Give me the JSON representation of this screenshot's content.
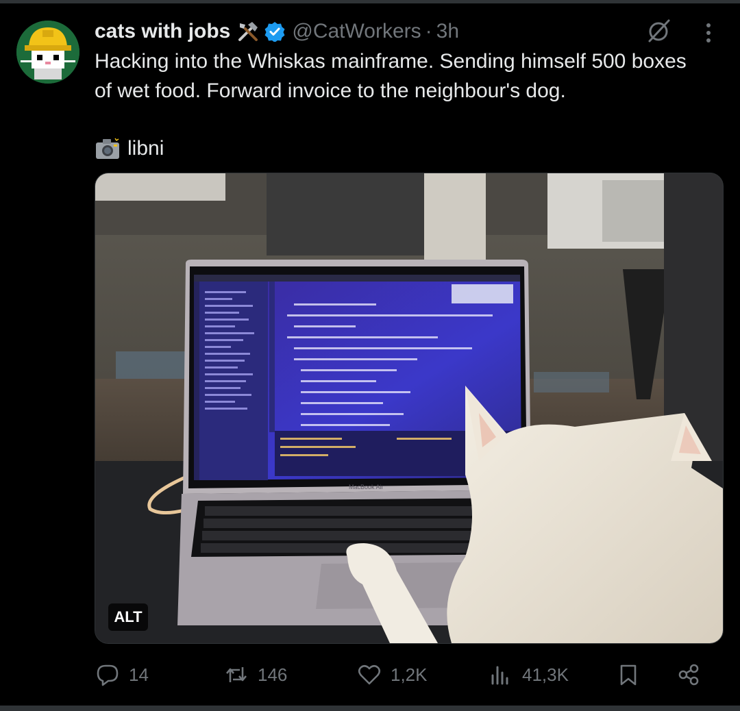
{
  "tweet": {
    "author_name": "cats with jobs",
    "handle": "@CatWorkers",
    "separator": "·",
    "time": "3h",
    "text": "Hacking into the Whiskas mainframe. Sending himself 500 boxes of wet food. Forward invoice to the neighbour's dog.",
    "credit": "libni",
    "media_alt_badge": "ALT",
    "laptop_brand_text": "MacBook Air"
  },
  "actions": {
    "replies": "14",
    "reposts": "146",
    "likes": "1,2K",
    "views": "41,3K"
  },
  "icons": {
    "badge": "tools-icon",
    "verified": "verified-icon",
    "grok": "grok-icon",
    "more": "more-icon",
    "camera": "camera-icon",
    "reply": "reply-icon",
    "repost": "repost-icon",
    "like": "heart-icon",
    "views": "views-icon",
    "bookmark": "bookmark-icon",
    "share": "share-icon"
  },
  "colors": {
    "background": "#000000",
    "text": "#e7e9ea",
    "muted": "#71767b",
    "verified": "#1d9bf0",
    "avatar_bg": "#1c6b3a",
    "hardhat": "#f2c318"
  }
}
